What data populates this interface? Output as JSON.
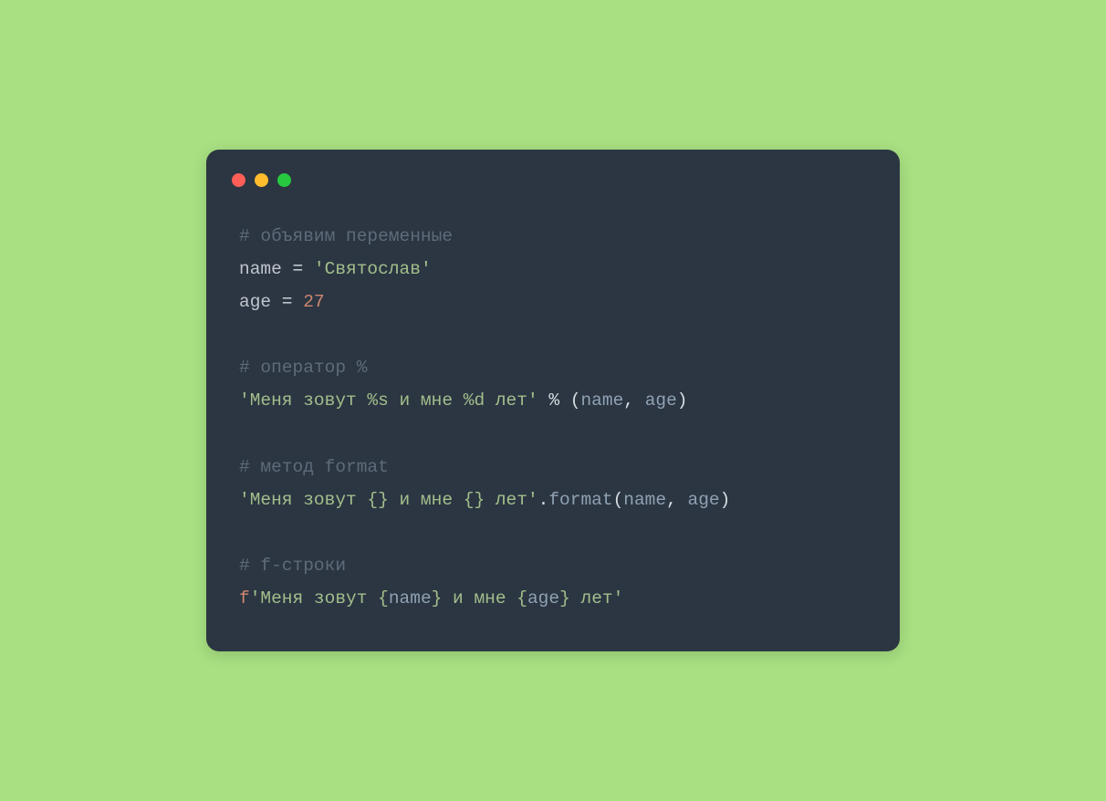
{
  "colors": {
    "background": "#a8e082",
    "window": "#2b3642",
    "dot_red": "#ff5f56",
    "dot_yellow": "#ffbd2e",
    "dot_green": "#27c93f",
    "comment": "#5f6b79",
    "string": "#a3be8c",
    "number": "#d08770",
    "identifier": "#8fa1b3",
    "default_text": "#d7dde3"
  },
  "code": {
    "line1_comment": "# объявим переменные",
    "line2_var": "name",
    "line2_eq": " = ",
    "line2_str": "'Святослав'",
    "line3_var": "age",
    "line3_eq": " = ",
    "line3_num": "27",
    "line5_comment": "# оператор %",
    "line6_str": "'Меня зовут %s и мне %d лет'",
    "line6_mid": " % (",
    "line6_arg1": "name",
    "line6_comma": ", ",
    "line6_arg2": "age",
    "line6_close": ")",
    "line8_comment": "# метод format",
    "line9_str": "'Меня зовут {} и мне {} лет'",
    "line9_dot": ".",
    "line9_func": "format",
    "line9_open": "(",
    "line9_arg1": "name",
    "line9_comma": ", ",
    "line9_arg2": "age",
    "line9_close": ")",
    "line11_comment": "# f-строки",
    "line12_prefix": "f",
    "line12_s1": "'Меня зовут ",
    "line12_b1o": "{",
    "line12_id1": "name",
    "line12_b1c": "}",
    "line12_s2": " и мне ",
    "line12_b2o": "{",
    "line12_id2": "age",
    "line12_b2c": "}",
    "line12_s3": " лет'"
  }
}
